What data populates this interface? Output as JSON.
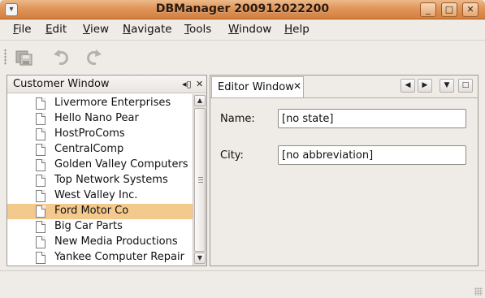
{
  "window": {
    "title": "DBManager 200912022200",
    "controls": {
      "minimize": "_",
      "maximize": "□",
      "close": "✕"
    }
  },
  "menu": [
    {
      "label": "File",
      "mnemonic": "F",
      "rest": "ile"
    },
    {
      "label": "Edit",
      "mnemonic": "E",
      "rest": "dit"
    },
    {
      "label": "View",
      "mnemonic": "V",
      "rest": "iew"
    },
    {
      "label": "Navigate",
      "mnemonic": "N",
      "rest": "avigate"
    },
    {
      "label": "Tools",
      "mnemonic": "T",
      "rest": "ools"
    },
    {
      "label": "Window",
      "mnemonic": "W",
      "rest": "indow"
    },
    {
      "label": "Help",
      "mnemonic": "H",
      "rest": "elp"
    }
  ],
  "toolbar": {
    "buttons": [
      {
        "icon": "save-all-icon",
        "enabled": false
      },
      {
        "icon": "undo-icon",
        "enabled": false
      },
      {
        "icon": "redo-icon",
        "enabled": false
      }
    ]
  },
  "customer_window": {
    "title": "Customer Window",
    "controls": {
      "minimize": "◂▯",
      "close": "✕"
    },
    "items": [
      {
        "label": "Livermore Enterprises",
        "selected": false
      },
      {
        "label": "Hello Nano Pear",
        "selected": false
      },
      {
        "label": "HostProComs",
        "selected": false
      },
      {
        "label": "CentralComp",
        "selected": false
      },
      {
        "label": "Golden Valley Computers",
        "selected": false
      },
      {
        "label": "Top Network Systems",
        "selected": false
      },
      {
        "label": "West Valley Inc.",
        "selected": false
      },
      {
        "label": "Ford Motor Co",
        "selected": true
      },
      {
        "label": "Big Car Parts",
        "selected": false
      },
      {
        "label": "New Media Productions",
        "selected": false
      },
      {
        "label": "Yankee Computer Repair",
        "selected": false
      }
    ],
    "scrollbar": {
      "up": "▲",
      "down": "▼"
    }
  },
  "editor_window": {
    "tab_label": "Editor Window",
    "tab_close": "✕",
    "nav": {
      "left": "◀",
      "right": "▶",
      "down": "▼",
      "maximize": "□"
    },
    "fields": {
      "name_label": "Name:",
      "name_value": "[no state]",
      "city_label": "City:",
      "city_value": "[no abbreviation]"
    }
  },
  "colors": {
    "titlebar": "#e0955a",
    "selection": "#f4c98e",
    "background": "#efebe7"
  }
}
